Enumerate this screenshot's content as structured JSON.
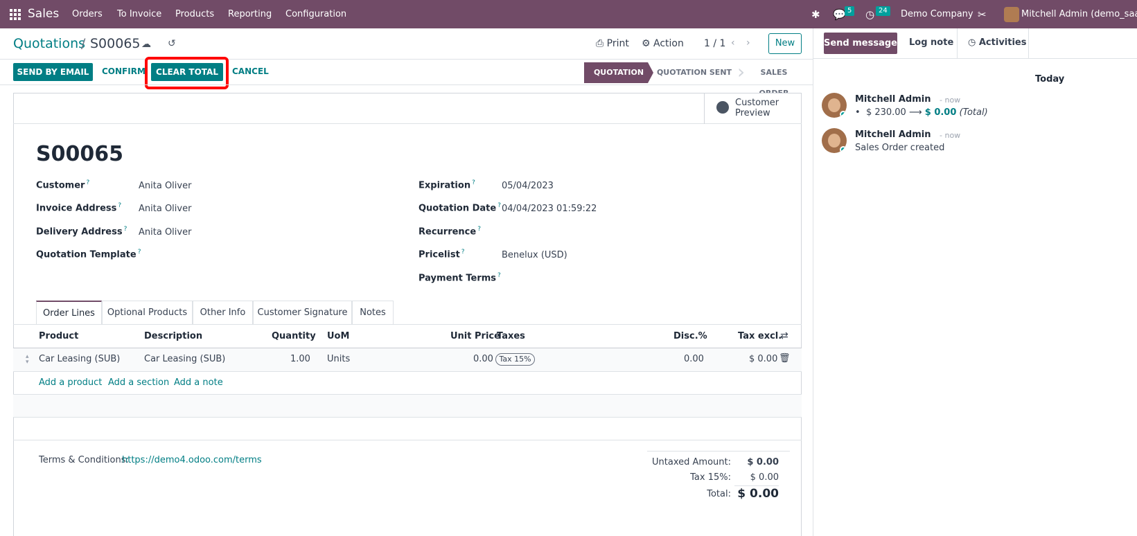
{
  "navbar": {
    "brand": "Sales",
    "menu": [
      "Orders",
      "To Invoice",
      "Products",
      "Reporting",
      "Configuration"
    ],
    "messages_count": "5",
    "activities_count": "24",
    "company": "Demo Company",
    "user": "Mitchell Admin (demo_saas-"
  },
  "control_panel": {
    "breadcrumb_parent": "Quotations",
    "breadcrumb_sep": "/",
    "breadcrumb_current": "S00065",
    "print_label": "Print",
    "action_label": "Action",
    "pager": "1 / 1",
    "new_label": "New"
  },
  "statusbar": {
    "send_by_email": "SEND BY EMAIL",
    "confirm": "CONFIRM",
    "clear_total": "CLEAR TOTAL",
    "cancel": "CANCEL",
    "steps": [
      "QUOTATION",
      "QUOTATION SENT",
      "SALES ORDER"
    ],
    "active_step": "QUOTATION"
  },
  "form": {
    "preview_line1": "Customer",
    "preview_line2": "Preview",
    "title": "S00065",
    "left_fields": [
      {
        "label": "Customer",
        "value": "Anita Oliver"
      },
      {
        "label": "Invoice Address",
        "value": "Anita Oliver"
      },
      {
        "label": "Delivery Address",
        "value": "Anita Oliver"
      },
      {
        "label": "Quotation Template",
        "value": ""
      }
    ],
    "right_fields": [
      {
        "label": "Expiration",
        "value": "05/04/2023"
      },
      {
        "label": "Quotation Date",
        "value": "04/04/2023 01:59:22"
      },
      {
        "label": "Recurrence",
        "value": ""
      },
      {
        "label": "Pricelist",
        "value": "Benelux (USD)"
      },
      {
        "label": "Payment Terms",
        "value": ""
      }
    ],
    "help_mark": "?",
    "tabs": [
      "Order Lines",
      "Optional Products",
      "Other Info",
      "Customer Signature",
      "Notes"
    ],
    "columns": [
      "Product",
      "Description",
      "Quantity",
      "UoM",
      "Unit Price",
      "Taxes",
      "Disc.%",
      "Tax excl."
    ],
    "lines": [
      {
        "product": "Car Leasing (SUB)",
        "description": "Car Leasing (SUB)",
        "quantity": "1.00",
        "uom": "Units",
        "unit_price": "0.00",
        "tax": "Tax 15%",
        "discount": "0.00",
        "subtotal": "$ 0.00"
      }
    ],
    "add_product": "Add a product",
    "add_section": "Add a section",
    "add_note": "Add a note",
    "terms_label": "Terms & Conditions:",
    "terms_link": "https://demo4.odoo.com/terms",
    "totals": {
      "untaxed_label": "Untaxed Amount:",
      "untaxed_value": "$ 0.00",
      "tax_label": "Tax 15%:",
      "tax_value": "$ 0.00",
      "total_label": "Total:",
      "total_value": "$ 0.00"
    }
  },
  "chatter": {
    "send_message": "Send message",
    "log_note": "Log note",
    "activities": "Activities",
    "today": "Today",
    "messages": [
      {
        "author": "Mitchell Admin",
        "time": "- now",
        "old_value": "$ 230.00",
        "arrow": "⟶",
        "new_value": "$ 0.00",
        "field": "(Total)"
      },
      {
        "author": "Mitchell Admin",
        "time": "- now",
        "body": "Sales Order created"
      }
    ]
  },
  "colors": {
    "brand": "#714b67",
    "accent": "#017e84",
    "highlight": "#ff0000"
  }
}
